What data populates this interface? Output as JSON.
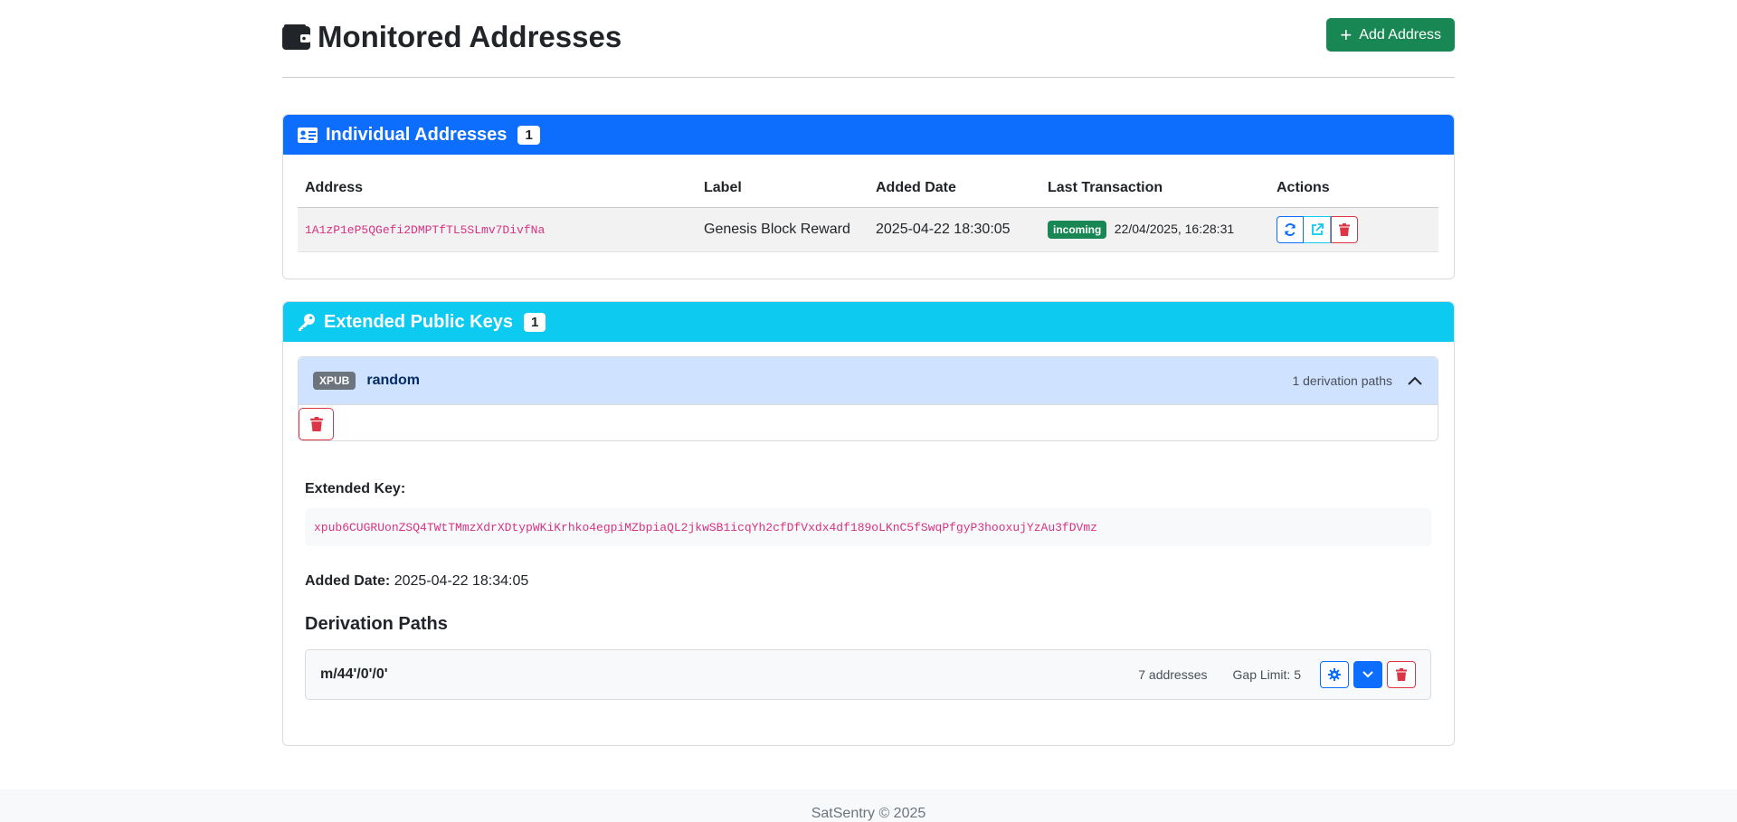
{
  "header": {
    "title": "Monitored Addresses",
    "add_button_label": "Add Address"
  },
  "individual": {
    "title": "Individual Addresses",
    "count": "1",
    "columns": [
      "Address",
      "Label",
      "Added Date",
      "Last Transaction",
      "Actions"
    ],
    "rows": [
      {
        "address": "1A1zP1eP5QGefi2DMPTfTL5SLmv7DivfNa",
        "label": "Genesis Block Reward",
        "added": "2025-04-22 18:30:05",
        "tx_badge": "incoming",
        "tx_time": "22/04/2025, 16:28:31"
      }
    ]
  },
  "xpubs": {
    "title": "Extended Public Keys",
    "count": "1",
    "item": {
      "badge": "XPUB",
      "name": "random",
      "paths_count": "1 derivation paths",
      "key_label": "Extended Key:",
      "key": "xpub6CUGRUonZSQ4TWtTMmzXdrXDtypWKiKrhko4egpiMZbpiaQL2jkwSB1icqYh2cfDfVxdx4df189oLKnC5fSwqPfgyP3hooxujYzAu3fDVmz",
      "added_label": "Added Date:",
      "added": "2025-04-22 18:34:05",
      "paths_heading": "Derivation Paths",
      "path": {
        "name": "m/44'/0'/0'",
        "addresses": "7 addresses",
        "gap_limit": "Gap Limit: 5"
      }
    }
  },
  "footer": {
    "text": "SatSentry © 2025"
  },
  "colors": {
    "primary": "#0d6efd",
    "info": "#0dcaf0",
    "success": "#198754",
    "danger": "#dc3545",
    "secondary": "#6c757d"
  }
}
